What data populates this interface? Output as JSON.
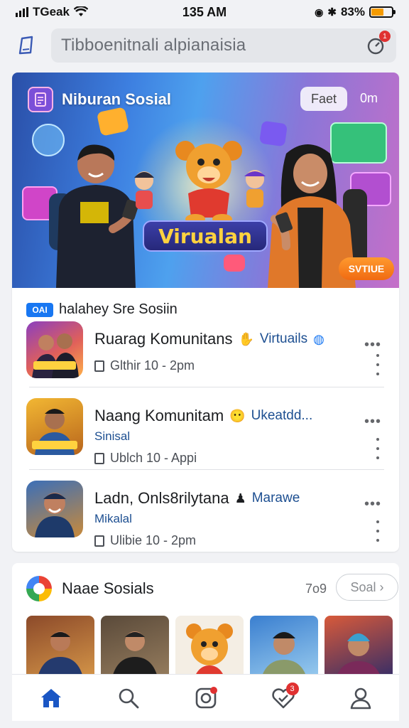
{
  "status_bar": {
    "carrier": "TGeak",
    "time": "135 AM",
    "battery": "83%"
  },
  "search": {
    "placeholder": "Tibboenitnali alpianaisia",
    "notification_badge": "1"
  },
  "hero": {
    "brand": "Niburan Sosial",
    "chip": "Faet",
    "chip2": "0m",
    "title": "Virualan",
    "cta": "SVTIUE"
  },
  "section": {
    "badge": "OAI",
    "label": "halahey Sre Sosiin"
  },
  "items": [
    {
      "title": "Ruarag Komunitans",
      "tag": "Virtuails",
      "time": "Glthir 10 - 2pm"
    },
    {
      "title": "Naang Komunitam",
      "tag": "Ukeatdd...",
      "subtitle": "Sinisal",
      "time": "Ublch 10 - Appi"
    },
    {
      "title": "Ladn, Onls8rilytana",
      "tag": "Marawe",
      "subtitle": "Mikalal",
      "time": "Ulibie 10 - 2pm"
    }
  ],
  "social_section": {
    "title": "Naae Sosials",
    "count": "7o9",
    "see_all": "Soal"
  },
  "colors": {
    "accent": "#1877f2",
    "badge": "#e03131",
    "cta": "#f06a12"
  },
  "nav": {
    "tabs": [
      {
        "icon": "home-icon",
        "active": true
      },
      {
        "icon": "search-icon"
      },
      {
        "icon": "instagram-icon",
        "dot": true
      },
      {
        "icon": "heart-check-icon",
        "badge": "3"
      },
      {
        "icon": "profile-icon"
      }
    ]
  }
}
